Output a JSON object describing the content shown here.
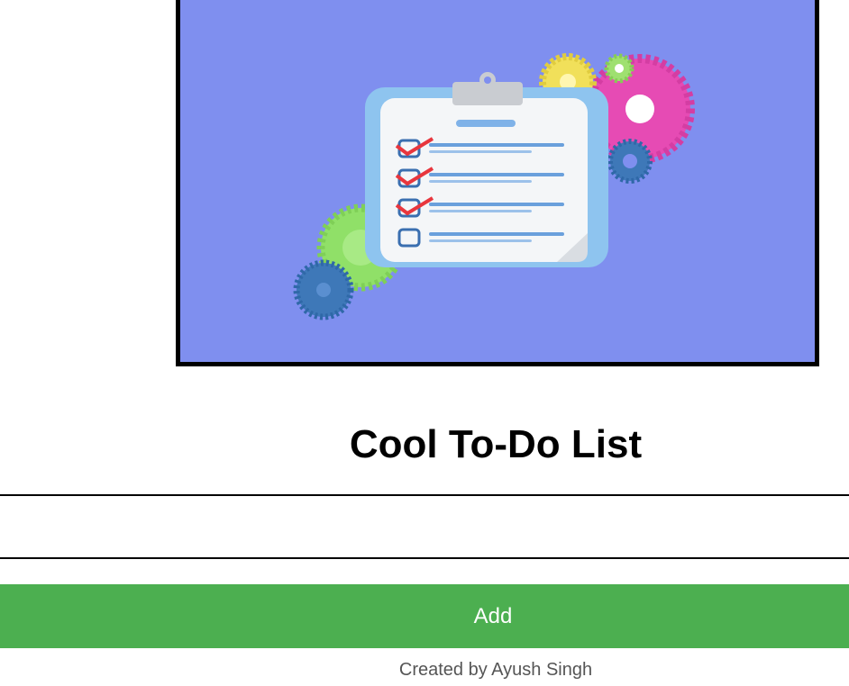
{
  "hero": {
    "image_alt": "clipboard-checklist-illustration",
    "background_color": "#7f8fef"
  },
  "app": {
    "title": "Cool To-Do List"
  },
  "form": {
    "task_input_value": "",
    "task_input_placeholder": "",
    "add_label": "Add"
  },
  "footer": {
    "credit": "Created by Ayush Singh"
  },
  "colors": {
    "add_button": "#4caf50",
    "footer_text": "#555555"
  }
}
